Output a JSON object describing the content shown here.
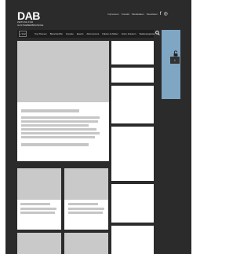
{
  "logo": {
    "text": "DAB",
    "sub1": "Zeitung für",
    "sub2": "Gastgeberbranche"
  },
  "top_links": [
    "Impressum",
    "Kontakt",
    "Mediadaten",
    "Newsletter"
  ],
  "social": {
    "facebook": "f",
    "instagram": "◎"
  },
  "nav": {
    "start_label": "Start",
    "items": [
      "Top-Themen",
      "Branchenfilm",
      "Impulse",
      "Events",
      "Abonnement",
      "Fakten & Zahlen",
      "Intern & Extern",
      "Stellenangebote"
    ],
    "search_icon": "search-icon"
  },
  "banner": {
    "info_label": "i",
    "color": "#7fa6c3"
  }
}
